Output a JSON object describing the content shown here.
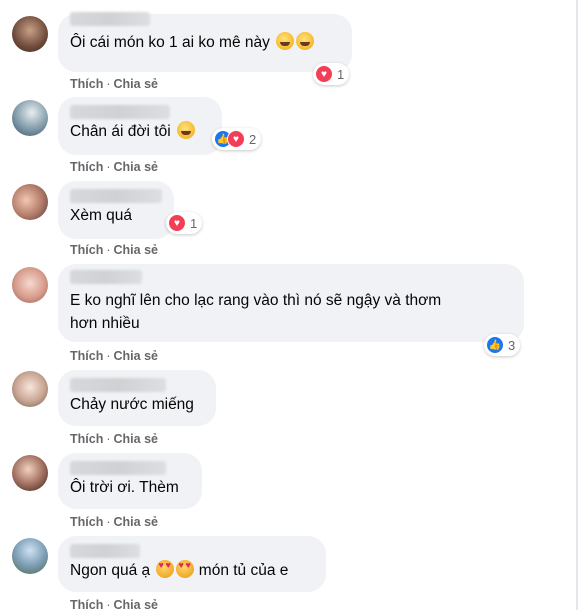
{
  "comments": [
    {
      "text": "Ôi cái món ko 1 ai ko mê này",
      "emojis": [
        "grin",
        "grin"
      ],
      "reactions": [
        "heart"
      ],
      "reaction_count": "1"
    },
    {
      "text": "Chân ái đời tôi",
      "emojis": [
        "grin"
      ],
      "reactions": [
        "like",
        "heart"
      ],
      "reaction_count": "2"
    },
    {
      "text": "Xèm quá",
      "emojis": [],
      "reactions": [
        "heart"
      ],
      "reaction_count": "1"
    },
    {
      "text": "E ko nghĩ lên cho lạc rang vào thì nó sẽ ngậy và thơm\nhơn nhiều",
      "emojis": [],
      "reactions": [
        "like"
      ],
      "reaction_count": "3"
    },
    {
      "text": "Chảy nước miếng",
      "emojis": [],
      "reactions": [],
      "reaction_count": ""
    },
    {
      "text": "Ôi trời ơi. Thèm",
      "emojis": [],
      "reactions": [],
      "reaction_count": ""
    },
    {
      "text_before": "Ngon quá ạ",
      "text_after": "món tủ của e",
      "emojis": [
        "love",
        "love"
      ],
      "reactions": [],
      "reaction_count": ""
    }
  ],
  "actions": {
    "like_label": "Thích",
    "separator": "·",
    "share_label": "Chia sẻ"
  },
  "colors": {
    "bubble": "#f0f2f5",
    "action_text": "#65676b",
    "like_blue": "#1877f2",
    "love_red": "#f33e58"
  },
  "icons": {
    "heart": "heart-reaction-icon",
    "like": "like-reaction-icon",
    "grin": "grinning-emoji-icon",
    "love": "heart-eyes-emoji-icon"
  }
}
